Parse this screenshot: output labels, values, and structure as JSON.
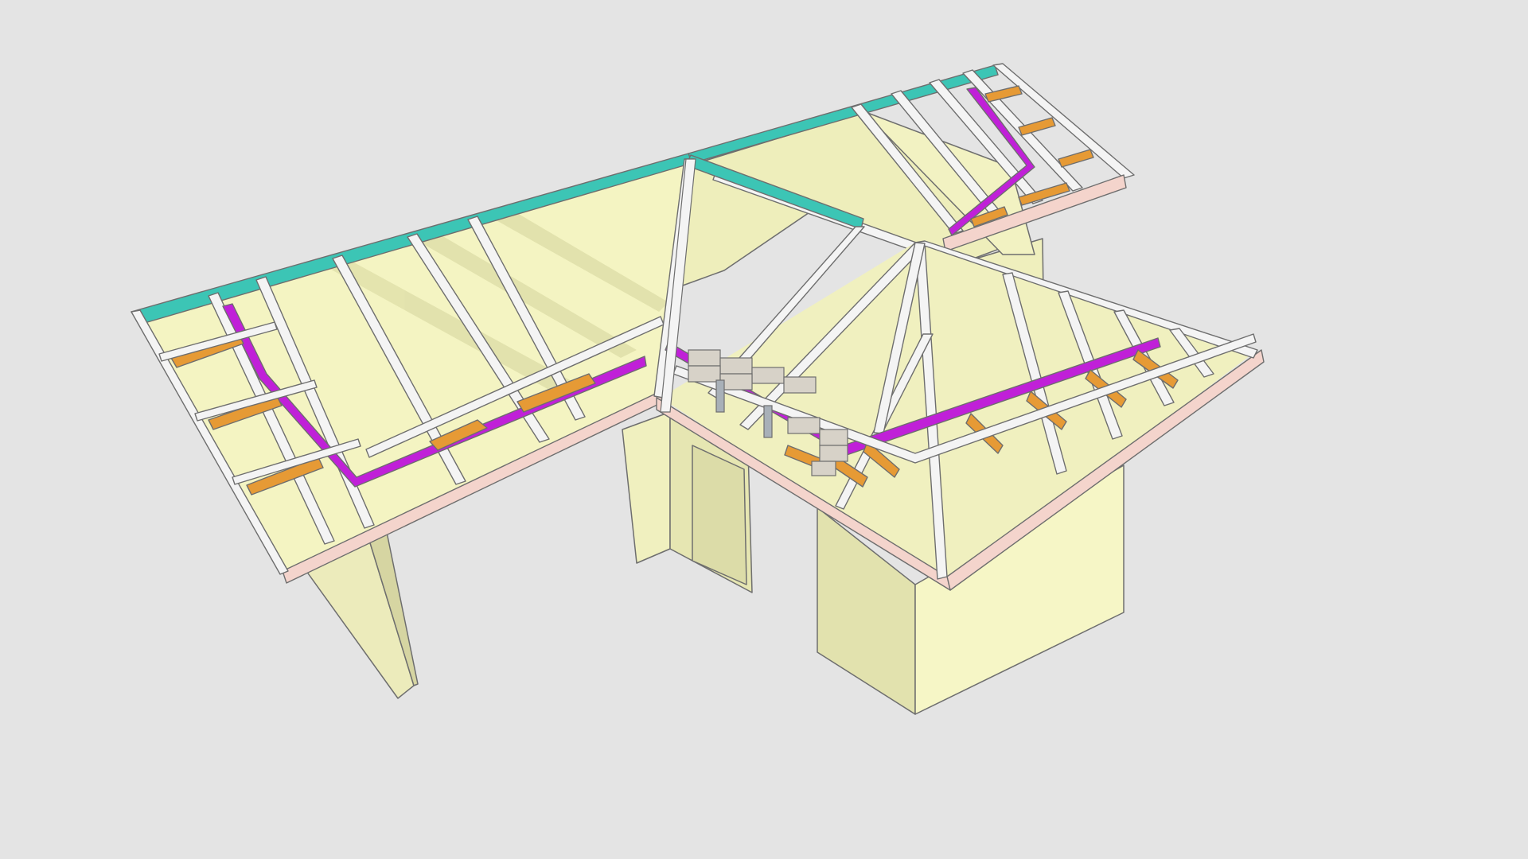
{
  "scene": {
    "background": "#e4e4e4",
    "colors": {
      "wall": "#f4f4c4",
      "wall_shade": "#d8d8a4",
      "wall_dark": "#c3c38e",
      "interior_panel": "#efefb8",
      "edge_outline": "#6e6e6e",
      "ridge_board": "#3cc5b5",
      "fascia": "#f4d4cc",
      "rafter": "#f4f4f4",
      "purlin_beam": "#c020d8",
      "strut": "#e69a35",
      "masonry": "#d7d2c8",
      "metal_post": "#a8b0b8",
      "shadow": "#c9c996"
    }
  }
}
